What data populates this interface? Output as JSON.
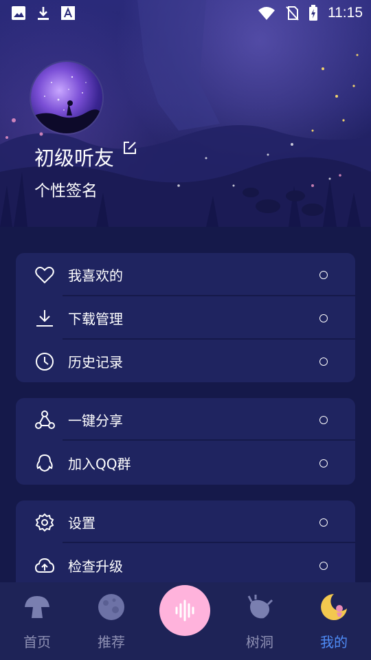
{
  "status_bar": {
    "time": "11:15"
  },
  "profile": {
    "username": "初级听友",
    "signature": "个性签名"
  },
  "menu_groups": [
    {
      "items": [
        {
          "icon": "heart-icon",
          "label": "我喜欢的"
        },
        {
          "icon": "download-icon",
          "label": "下载管理"
        },
        {
          "icon": "clock-icon",
          "label": "历史记录"
        }
      ]
    },
    {
      "items": [
        {
          "icon": "share-icon",
          "label": "一键分享"
        },
        {
          "icon": "qq-icon",
          "label": "加入QQ群"
        }
      ]
    },
    {
      "items": [
        {
          "icon": "gear-icon",
          "label": "设置"
        },
        {
          "icon": "cloud-upload-icon",
          "label": "检查升级"
        }
      ]
    }
  ],
  "bottom_nav": {
    "items": [
      {
        "icon": "mushroom-icon",
        "label": "首页",
        "active": false
      },
      {
        "icon": "moon-planet-icon",
        "label": "推荐",
        "active": false
      },
      {
        "icon": "sound-wave-icon",
        "label": "",
        "active": false
      },
      {
        "icon": "tree-hole-icon",
        "label": "树洞",
        "active": false
      },
      {
        "icon": "crescent-moon-icon",
        "label": "我的",
        "active": true
      }
    ]
  },
  "colors": {
    "background": "#15194a",
    "card": "#1f2460",
    "accent_active": "#4f8cf7",
    "center_button": "#ffb3dc"
  }
}
